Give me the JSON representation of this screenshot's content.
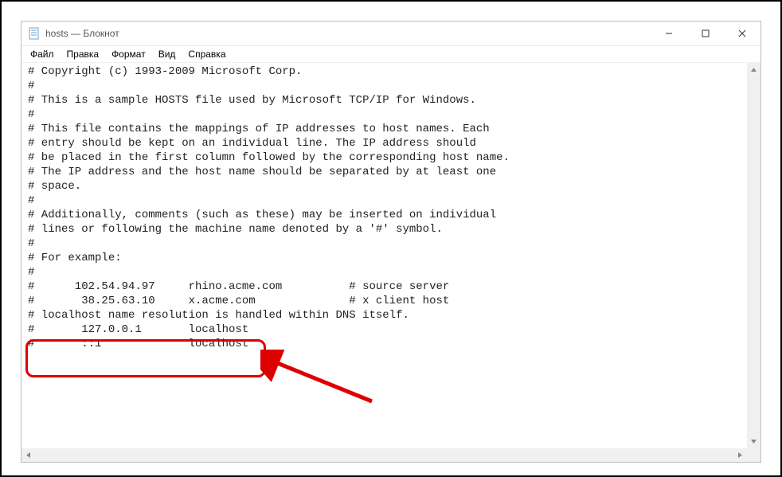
{
  "window": {
    "title": "hosts — Блокнот",
    "buttons": {
      "min": "minimize",
      "max": "maximize",
      "close": "close"
    }
  },
  "menu": {
    "file": "Файл",
    "edit": "Правка",
    "format": "Формат",
    "view": "Вид",
    "help": "Справка"
  },
  "editor": {
    "lines": [
      "# Copyright (c) 1993-2009 Microsoft Corp.",
      "#",
      "# This is a sample HOSTS file used by Microsoft TCP/IP for Windows.",
      "#",
      "# This file contains the mappings of IP addresses to host names. Each",
      "# entry should be kept on an individual line. The IP address should",
      "# be placed in the first column followed by the corresponding host name.",
      "# The IP address and the host name should be separated by at least one",
      "# space.",
      "#",
      "# Additionally, comments (such as these) may be inserted on individual",
      "# lines or following the machine name denoted by a '#' symbol.",
      "#",
      "# For example:",
      "#",
      "#      102.54.94.97     rhino.acme.com          # source server",
      "#       38.25.63.10     x.acme.com              # x client host",
      "# localhost name resolution is handled within DNS itself.",
      "#       127.0.0.1       localhost",
      "#       ::1             localhost"
    ]
  },
  "annotation": {
    "callout_target": "last-two-lines",
    "arrow": "pointing-to-callout"
  }
}
